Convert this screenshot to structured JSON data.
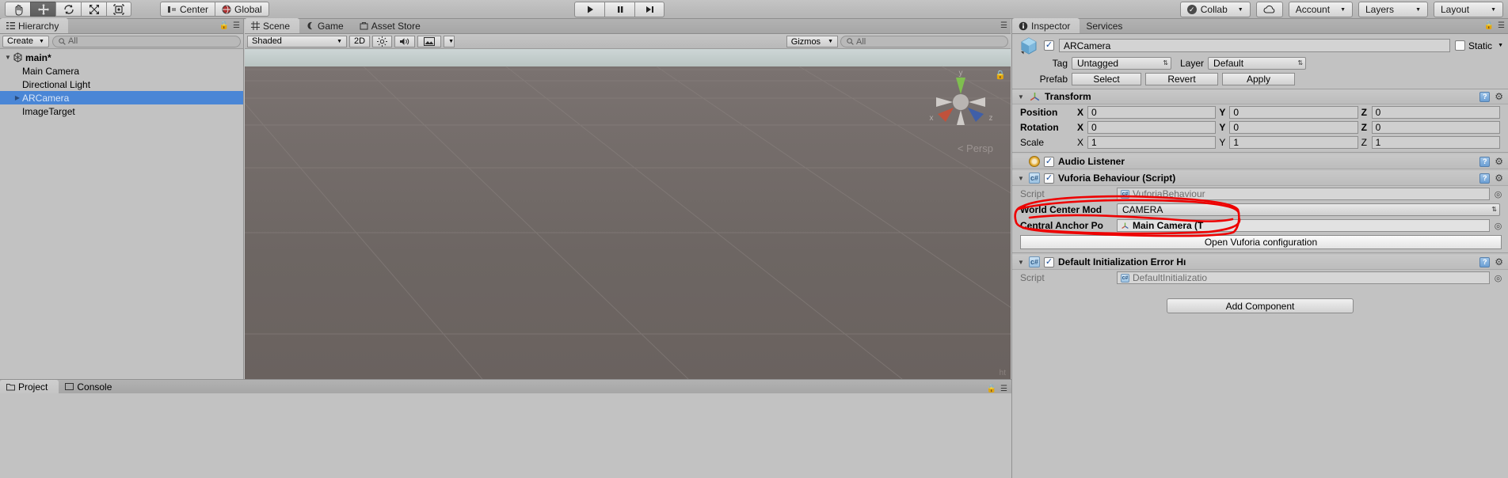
{
  "toolbar": {
    "tools": [
      {
        "name": "hand-tool",
        "icon": "hand",
        "active": false
      },
      {
        "name": "move-tool",
        "icon": "move",
        "active": true
      },
      {
        "name": "rotate-tool",
        "icon": "rotate",
        "active": false
      },
      {
        "name": "scale-tool",
        "icon": "scale",
        "active": false
      },
      {
        "name": "rect-tool",
        "icon": "rect",
        "active": false
      }
    ],
    "pivot_label": "Center",
    "space_label": "Global",
    "play_label": "▶",
    "pause_label": "❙❙",
    "step_label": "▶❙",
    "collab_label": "Collab",
    "cloud_label": "cloud-icon",
    "account_label": "Account",
    "layers_label": "Layers",
    "layout_label": "Layout"
  },
  "hierarchy": {
    "tab_label": "Hierarchy",
    "create_label": "Create",
    "search_placeholder": "All",
    "items": [
      {
        "label": "main*",
        "depth": 0,
        "expanded": true,
        "selected": false,
        "root": true,
        "arrow": true
      },
      {
        "label": "Main Camera",
        "depth": 1,
        "expanded": false,
        "selected": false,
        "root": false,
        "arrow": false
      },
      {
        "label": "Directional Light",
        "depth": 1,
        "expanded": false,
        "selected": false,
        "root": false,
        "arrow": false
      },
      {
        "label": "ARCamera",
        "depth": 1,
        "expanded": false,
        "selected": true,
        "root": false,
        "arrow": true
      },
      {
        "label": "ImageTarget",
        "depth": 1,
        "expanded": false,
        "selected": false,
        "root": false,
        "arrow": false
      }
    ]
  },
  "scene": {
    "tabs": [
      {
        "label": "Scene",
        "active": true,
        "icon": "grid-icon"
      },
      {
        "label": "Game",
        "active": false,
        "icon": "gamepad-icon"
      },
      {
        "label": "Asset Store",
        "active": false,
        "icon": "store-icon"
      }
    ],
    "draw_mode": "Shaded",
    "mode_2d": "2D",
    "lighting_icon": "sun-icon",
    "audio_icon": "speaker-icon",
    "fx_icon": "image-icon",
    "gizmos_label": "Gizmos",
    "gizmos_search_placeholder": "All",
    "persp_label": "Persp",
    "axis_x": "x",
    "axis_y": "y",
    "axis_z": "z"
  },
  "inspector": {
    "tabs": [
      {
        "label": "Inspector",
        "active": true
      },
      {
        "label": "Services",
        "active": false
      }
    ],
    "object_name": "ARCamera",
    "object_enabled": true,
    "static_label": "Static",
    "static_checked": false,
    "tag_label": "Tag",
    "tag_value": "Untagged",
    "layer_label": "Layer",
    "layer_value": "Default",
    "prefab_label": "Prefab",
    "prefab_select": "Select",
    "prefab_revert": "Revert",
    "prefab_apply": "Apply",
    "components": [
      {
        "title": "Transform",
        "icon": "transform-icon",
        "enabled": null,
        "expanded": true,
        "rows": [
          {
            "name": "Position",
            "x": "0",
            "y": "0",
            "z": "0"
          },
          {
            "name": "Rotation",
            "x": "0",
            "y": "0",
            "z": "0"
          },
          {
            "name": "Scale",
            "x": "1",
            "y": "1",
            "z": "1"
          }
        ]
      },
      {
        "title": "Audio Listener",
        "icon": "audio-listener-icon",
        "enabled": true,
        "expanded": false
      },
      {
        "title": "Vuforia Behaviour (Script)",
        "icon": "script-icon",
        "enabled": true,
        "expanded": true,
        "script_label": "Script",
        "script_value": "VuforiaBehaviour",
        "props": [
          {
            "label": "World Center Mod",
            "value": "CAMERA",
            "kind": "enum"
          },
          {
            "label": "Central Anchor Po",
            "value": "Main Camera (T",
            "kind": "object"
          }
        ],
        "button_label": "Open Vuforia configuration"
      },
      {
        "title": "Default Initialization Error Hı",
        "icon": "script-icon",
        "enabled": true,
        "expanded": true,
        "script_label": "Script",
        "script_value": "DefaultInitializatio"
      }
    ],
    "add_component_label": "Add Component"
  },
  "bottom": {
    "tabs": [
      {
        "label": "Project",
        "active": true,
        "icon": "folder-icon"
      },
      {
        "label": "Console",
        "active": false,
        "icon": "console-icon"
      }
    ]
  },
  "annotation": {
    "color": "#ee0000",
    "note": "hand-drawn red ellipse around World Center Mode and Central Anchor Point rows"
  },
  "colors": {
    "selection_blue": "#4a86d6",
    "panel_gray": "#c2c2c2",
    "scene_ground": "#6d6663",
    "annotation_red": "#ee0000"
  }
}
